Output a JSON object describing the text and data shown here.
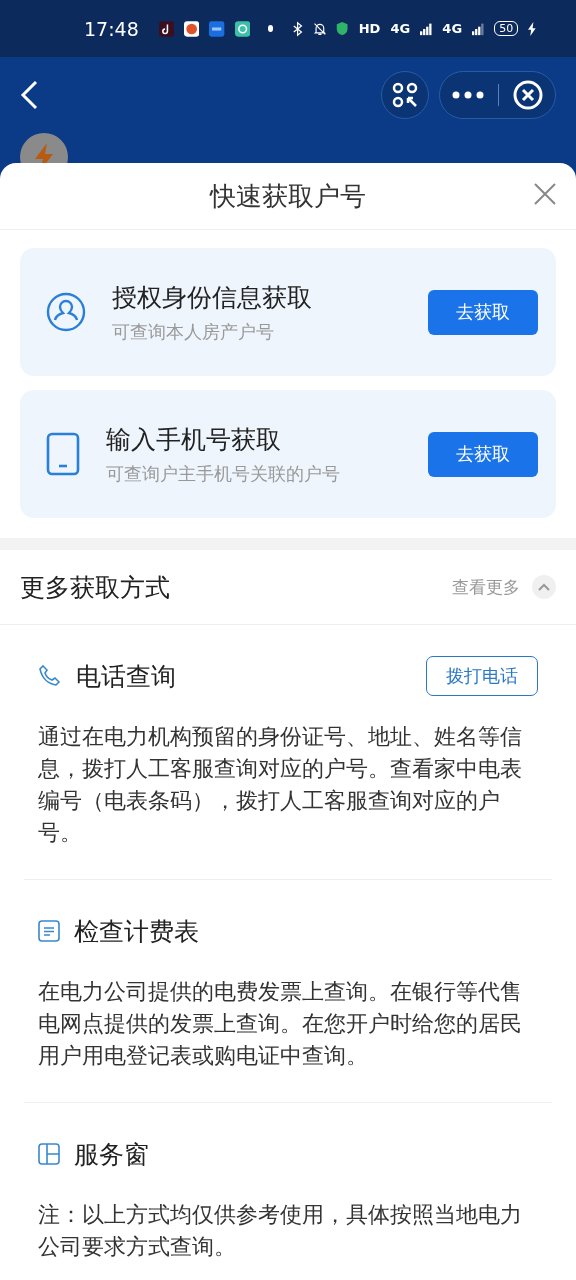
{
  "status_bar": {
    "time": "17:48",
    "network_labels": [
      "HD",
      "4G",
      "4G"
    ],
    "battery": "50"
  },
  "sheet": {
    "title": "快速获取户号",
    "options": [
      {
        "kind": "person",
        "title": "授权身份信息获取",
        "subtitle": "可查询本人房产户号",
        "button": "去获取"
      },
      {
        "kind": "phone",
        "title": "输入手机号获取",
        "subtitle": "可查询户主手机号关联的户号",
        "button": "去获取"
      }
    ],
    "more": {
      "title": "更多获取方式",
      "link": "查看更多",
      "expanded": true
    },
    "methods": [
      {
        "kind": "call",
        "title": "电话查询",
        "button": "拨打电话",
        "text": "通过在电力机构预留的身份证号、地址、姓名等信息，拨打人工客服查询对应的户号。查看家中电表编号（电表条码），拨打人工客服查询对应的户号。"
      },
      {
        "kind": "doc",
        "title": "检查计费表",
        "text": "在电力公司提供的电费发票上查询。在银行等代售电网点提供的发票上查询。在您开户时给您的居民用户用电登记表或购电证中查询。"
      },
      {
        "kind": "window",
        "title": "服务窗",
        "text": "注：以上方式均仅供参考使用，具体按照当地电力公司要求方式查询。"
      }
    ]
  }
}
